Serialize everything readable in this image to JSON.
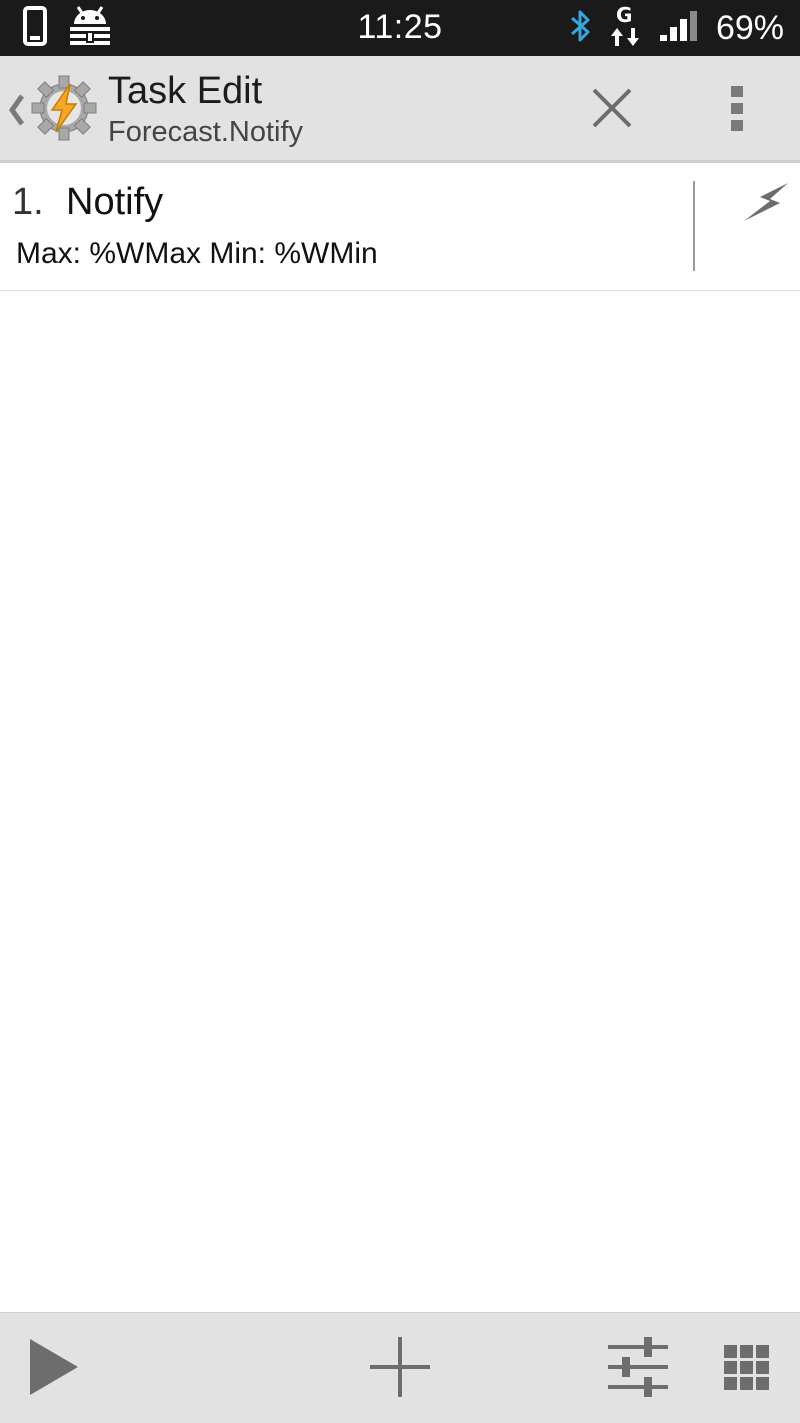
{
  "status_bar": {
    "time": "11:25",
    "battery": "69%",
    "network_type": "G",
    "icons": [
      "phone-icon",
      "android-debug-icon",
      "bluetooth-icon",
      "data-transfer-icon",
      "signal-icon"
    ]
  },
  "action_bar": {
    "title": "Task Edit",
    "subtitle": "Forecast.Notify",
    "icons": [
      "back-chevron-icon",
      "tasker-logo-icon",
      "close-icon",
      "overflow-menu-icon"
    ]
  },
  "actions": [
    {
      "index": "1.",
      "name": "Notify",
      "params": "Max: %WMax Min: %WMin",
      "icon": "lightning-bolt-icon"
    }
  ],
  "bottom_bar": {
    "icons": [
      "play-icon",
      "add-icon",
      "settings-sliders-icon",
      "grid-icon"
    ]
  },
  "colors": {
    "status_bar_bg": "#1a1a1a",
    "action_bar_bg": "#e2e2e2",
    "icon_gray": "#6d6d6d",
    "bluetooth_blue": "#33a8e0",
    "tasker_orange": "#f6a623"
  }
}
